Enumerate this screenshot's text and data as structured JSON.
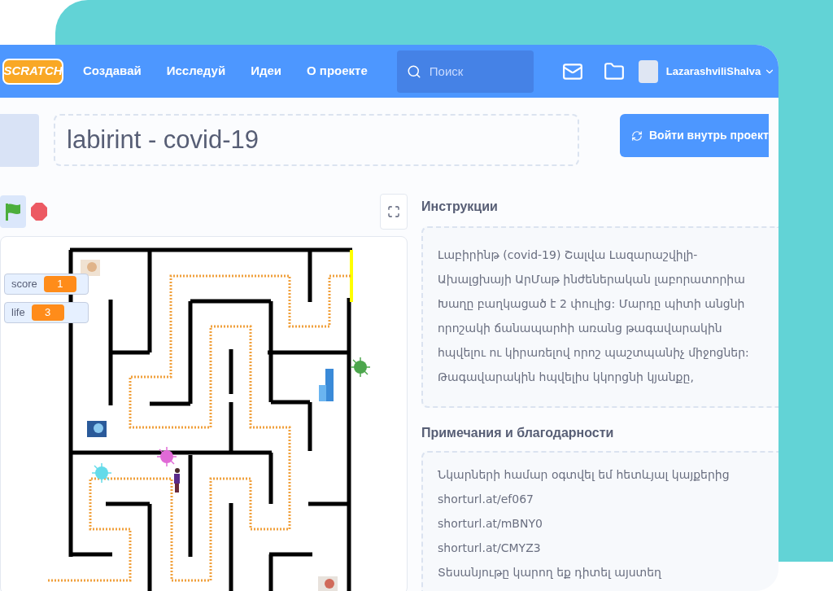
{
  "nav": {
    "logo": "SCRATCH",
    "items": [
      "Создавай",
      "Исследуй",
      "Идеи",
      "О проекте"
    ],
    "search": {
      "placeholder": "Поиск"
    },
    "username": "LazarashviliShalva"
  },
  "project": {
    "title": "labirint - covid-19",
    "see_inside": "Войти внутрь проект"
  },
  "stage": {
    "monitors": [
      {
        "label": "score",
        "value": "1"
      },
      {
        "label": "life",
        "value": "3"
      }
    ]
  },
  "instructions": {
    "heading": "Инструкции",
    "lines": [
      "Լաբիրինթ (covid-19) Շալվա Լազարաշվիլի-",
      "Ախալցխայի ԱրՄաթ ինժեներական լաբորատորիա",
      "Խաղը բաղկացած է 2 փուլից: Մարդը պիտի անցնի",
      "որոշակի ճանապարհի առանց թագավարակին",
      "հպվելու ու կիրառելով որոշ պաշտպանիչ միջոցներ:",
      "Թագավարակին հպվելիս կկորցնի կյանքը,"
    ]
  },
  "notes": {
    "heading": "Примечания и благодарности",
    "lines": [
      "Նկարների համար օգտվել եմ հետևյալ կայքերից",
      "shorturl.at/ef067",
      "shorturl.at/mBNY0",
      "shorturl.at/CMYZ3",
      "Տեսանյութը կարող եք դիտել այստեղ"
    ]
  }
}
